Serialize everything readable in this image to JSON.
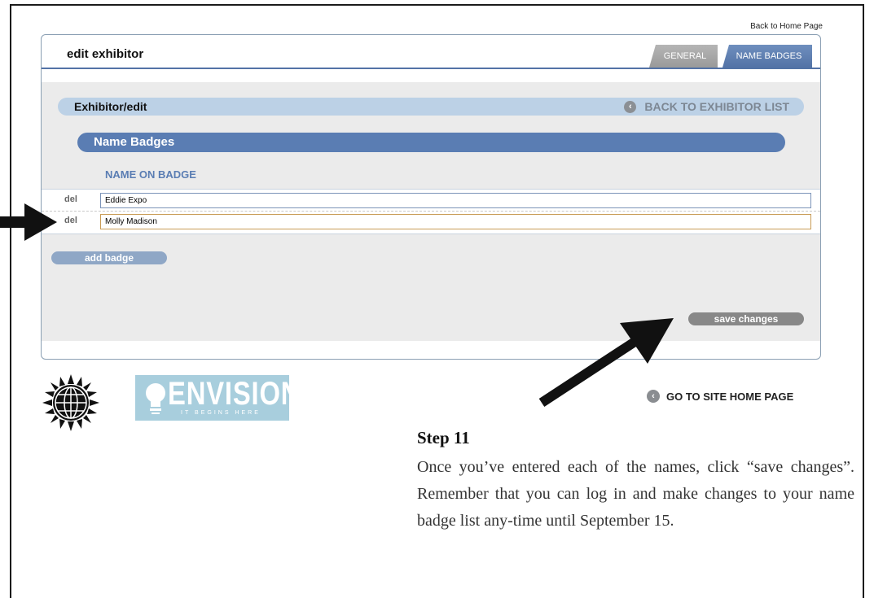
{
  "header": {
    "back_home_link": "Back to Home Page"
  },
  "panel": {
    "title": "edit exhibitor",
    "tabs": [
      {
        "label": "GENERAL",
        "active": false
      },
      {
        "label": "NAME BADGES",
        "active": true
      }
    ],
    "subheader": {
      "title": "Exhibitor/edit",
      "back_link": "BACK TO EXHIBITOR LIST"
    },
    "section_title": "Name Badges",
    "column_header": "NAME ON BADGE",
    "badges": [
      {
        "delete_label": "del",
        "name": "Eddie Expo"
      },
      {
        "delete_label": "del",
        "name": "Molly Madison"
      }
    ],
    "add_badge_label": "add badge",
    "save_label": "save changes"
  },
  "footer": {
    "logo_text": "ENVISION",
    "logo_tagline": "IT BEGINS HERE",
    "site_home_link": "GO TO SITE HOME PAGE"
  },
  "instructions": {
    "step_title": "Step 11",
    "step_text": "Once you’ve entered each of the names, click “save changes”. Remember that you can log in and make changes to your name badge list any-time until September 15."
  },
  "colors": {
    "accent": "#5a7db3",
    "light_accent": "#bcd1e6",
    "tab_inactive": "#a8a8a8",
    "button_gray": "#888888"
  }
}
